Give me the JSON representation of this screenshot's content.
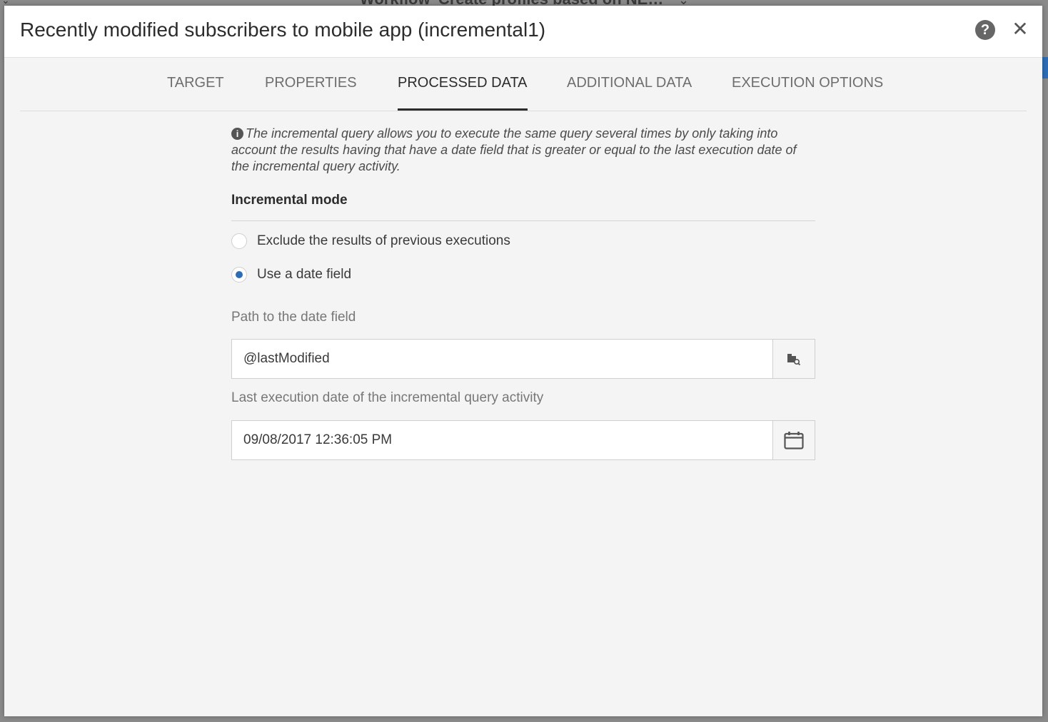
{
  "background": {
    "window_title": "Workflow 'Create profiles based on NE…"
  },
  "modal": {
    "title": "Recently modified subscribers to mobile app (incremental1)",
    "help_glyph": "?",
    "close_glyph": "✕"
  },
  "tabs": [
    {
      "label": "TARGET",
      "active": false
    },
    {
      "label": "PROPERTIES",
      "active": false
    },
    {
      "label": "PROCESSED DATA",
      "active": true
    },
    {
      "label": "ADDITIONAL DATA",
      "active": false
    },
    {
      "label": "EXECUTION OPTIONS",
      "active": false
    }
  ],
  "processed_data": {
    "info_glyph": "i",
    "info_text": "The incremental query allows you to execute the same query several times by only taking into account the results having that have a date field that is greater or equal to the last execution date of the incremental query activity.",
    "incremental_mode": {
      "heading": "Incremental mode",
      "options": [
        {
          "label": "Exclude the results of previous executions",
          "selected": false
        },
        {
          "label": "Use a date field",
          "selected": true
        }
      ]
    },
    "date_path": {
      "label": "Path to the date field",
      "value": "@lastModified",
      "button_icon": "schema-browse-icon"
    },
    "last_execution": {
      "label": "Last execution date of the incremental query activity",
      "value": "09/08/2017 12:36:05 PM",
      "button_icon": "calendar-icon"
    }
  },
  "colors": {
    "accent": "#2d6db6",
    "modal_bg": "#f4f4f4",
    "header_bg": "#ffffff",
    "text_primary": "#2c2c2c",
    "text_muted": "#777777"
  }
}
